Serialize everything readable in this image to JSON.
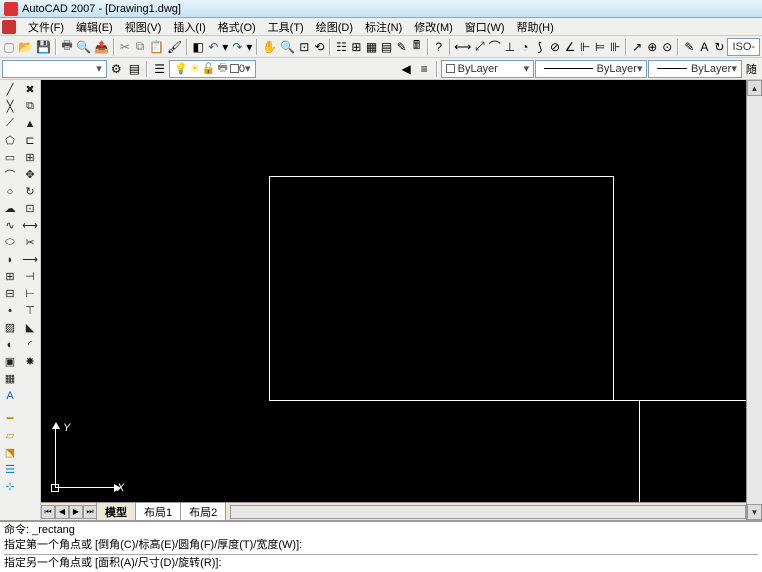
{
  "titlebar": {
    "app": "AutoCAD 2007",
    "doc": "[Drawing1.dwg]"
  },
  "menubar": [
    "文件(F)",
    "编辑(E)",
    "视图(V)",
    "插入(I)",
    "格式(O)",
    "工具(T)",
    "绘图(D)",
    "标注(N)",
    "修改(M)",
    "窗口(W)",
    "帮助(H)"
  ],
  "toolbar2_layer_combo": "0",
  "toolbar2_layer_dropdown": "0",
  "props": {
    "color": "ByLayer",
    "linetype": "ByLayer",
    "lineweight": "ByLayer",
    "stylebox": "ISO-"
  },
  "tabs": {
    "model": "模型",
    "layout1": "布局1",
    "layout2": "布局2"
  },
  "command": {
    "l1": "命令: _rectang",
    "l2": "指定第一个角点或 [倒角(C)/标高(E)/圆角(F)/厚度(T)/宽度(W)]:",
    "l3": "指定另一个角点或 [面积(A)/尺寸(D)/旋转(R)]:"
  },
  "ucs": {
    "x": "X",
    "y": "Y"
  },
  "style_label": "随"
}
